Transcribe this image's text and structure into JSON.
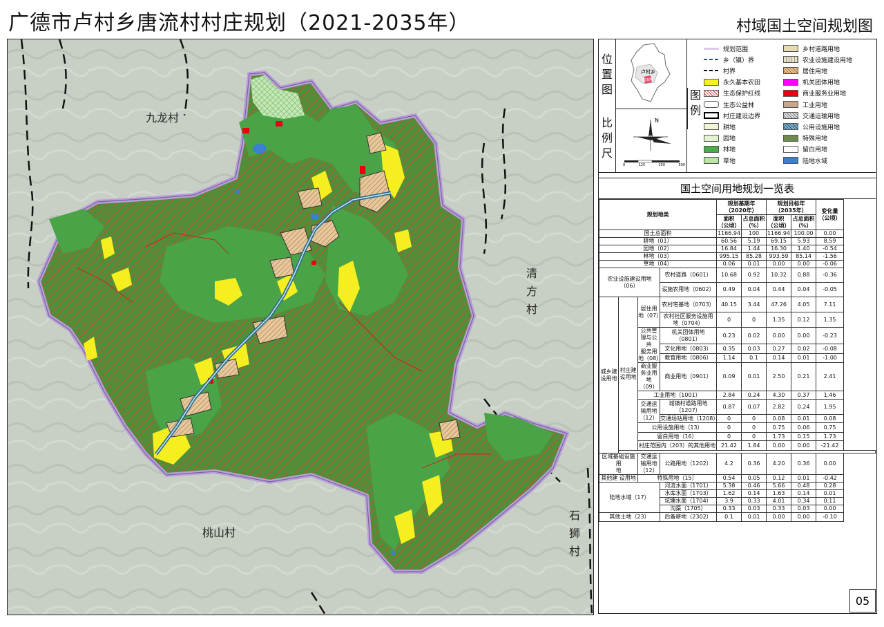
{
  "title": "广德市卢村乡唐流村村庄规划（2021-2035年）",
  "subtitle": "村域国土空间规划图",
  "village_labels": {
    "jiulong": "九龙村",
    "qingfang": "清方村",
    "taoshan": "桃山村",
    "shishi": "石狮村"
  },
  "side_captions": {
    "location": "位置图",
    "scale": "比例尺",
    "legend": "图例"
  },
  "location_map": {
    "region_label": "卢村乡",
    "village_tag": "唐流村"
  },
  "scale_bar": {
    "north": "N",
    "ticks": [
      "0",
      "125",
      "250",
      "",
      "500"
    ]
  },
  "legend": [
    {
      "label": "规划范围",
      "swatch": "#d8c8e8",
      "kind": "line-purple"
    },
    {
      "label": "乡村道路用地",
      "swatch": "#e4dcb0"
    },
    {
      "label": "乡（镇）界",
      "swatch": "#1f4e9c",
      "kind": "line-dash-blue"
    },
    {
      "label": "农业设施建设用地",
      "swatch": "#e9e1c4",
      "kind": "hatch-thin"
    },
    {
      "label": "村界",
      "swatch": "#000000",
      "kind": "line-dash"
    },
    {
      "label": "居住用地",
      "swatch": "#f2c78e",
      "kind": "hatch-brown"
    },
    {
      "label": "永久基本农田",
      "swatch": "#f5f221"
    },
    {
      "label": "机关团体用地",
      "swatch": "#ff00ff"
    },
    {
      "label": "生态保护红线",
      "swatch": "#ffffff",
      "kind": "hatch-red"
    },
    {
      "label": "商业服务业用地",
      "swatch": "#e60012"
    },
    {
      "label": "生态公益林",
      "swatch": "#ffffff",
      "kind": "outline-round"
    },
    {
      "label": "工业用地",
      "swatch": "#c9a58a"
    },
    {
      "label": "村庄建设边界",
      "swatch": "#ffffff",
      "kind": "outline-bold"
    },
    {
      "label": "交通运输用地",
      "swatch": "#b9b9b9",
      "kind": "hatch-gray"
    },
    {
      "label": "耕地",
      "swatch": "#f2f5d8"
    },
    {
      "label": "公用设施用地",
      "swatch": "#2d6e8c",
      "kind": "hatch-teal"
    },
    {
      "label": "园地",
      "swatch": "#e4f3cf"
    },
    {
      "label": "特殊用地",
      "swatch": "#6f8a4a"
    },
    {
      "label": "林地",
      "swatch": "#4cab4c"
    },
    {
      "label": "留白用地",
      "swatch": "#ffffff"
    },
    {
      "label": "草地",
      "swatch": "#b9e6a2"
    },
    {
      "label": "陆地水域",
      "swatch": "#3a7fd0"
    }
  ],
  "table": {
    "title": "国土空间用地规划一览表",
    "header": {
      "category": "规划地类",
      "base_year": "规划基期年\n（2020年）",
      "target_year": "规划目标年\n（2035年）",
      "change": "变化量\n（公顷）",
      "area": "面积\n（公顷）",
      "share": "占总面积\n（%）"
    },
    "rows": [
      {
        "c1": "国土总面积",
        "v": [
          "1166.94",
          "100",
          "1166.94",
          "100.00",
          "0.00"
        ]
      },
      {
        "c1": "耕地（01）",
        "v": [
          "60.56",
          "5.19",
          "69.15",
          "5.93",
          "8.59"
        ]
      },
      {
        "c1": "园地（02）",
        "v": [
          "16.84",
          "1.44",
          "16.30",
          "1.40",
          "-0.54"
        ]
      },
      {
        "c1": "林地（03）",
        "v": [
          "995.15",
          "85.28",
          "993.59",
          "85.14",
          "-1.56"
        ]
      },
      {
        "c1": "草地（04）",
        "v": [
          "0.06",
          "0.01",
          "0.00",
          "0.00",
          "-0.06"
        ]
      }
    ],
    "agri": {
      "group": "农业设施建设用地\n（06）",
      "rows": [
        {
          "c": "农村道路（0601）",
          "v": [
            "10.68",
            "0.92",
            "10.32",
            "0.88",
            "-0.36"
          ]
        },
        {
          "c": "设施农用地（0602）",
          "v": [
            "0.49",
            "0.04",
            "0.44",
            "0.04",
            "-0.05"
          ]
        }
      ]
    },
    "urban": {
      "group": "城乡建\n设用地",
      "sub": "村庄建\n设用地",
      "residential": "居住用地（07）",
      "res_rows": [
        {
          "c": "农村宅基地（0703）",
          "v": [
            "40.15",
            "3.44",
            "47.26",
            "4.05",
            "7.11"
          ]
        },
        {
          "c": "农村社区服务设施用\n地（0704）",
          "v": [
            "0",
            "0",
            "1.35",
            "0.12",
            "1.35"
          ]
        }
      ],
      "public": "公共管理与公共\n服务用地（08）",
      "pub_rows": [
        {
          "c": "机关团体用地\n（0801）",
          "v": [
            "0.23",
            "0.02",
            "0.00",
            "0.00",
            "-0.23"
          ]
        },
        {
          "c": "文化用地（0803）",
          "v": [
            "0.35",
            "0.03",
            "0.27",
            "0.02",
            "-0.08"
          ]
        },
        {
          "c": "教育用地（0806）",
          "v": [
            "1.14",
            "0.1",
            "0.14",
            "0.01",
            "-1.00"
          ]
        }
      ],
      "commercial": "商业服务业用地\n（09）",
      "com_row": {
        "c": "商业用地（0901）",
        "v": [
          "0.09",
          "0.01",
          "2.50",
          "0.21",
          "2.41"
        ]
      },
      "industrial": {
        "c": "工业用地（1001）",
        "v": [
          "2.84",
          "0.24",
          "4.30",
          "0.37",
          "1.46"
        ]
      },
      "transport": "交通运输用地\n（12）",
      "trans_rows": [
        {
          "c": "城镇村道路用地\n（1207）",
          "v": [
            "0.87",
            "0.07",
            "2.82",
            "0.24",
            "1.95"
          ]
        },
        {
          "c": "交通场站用地（1208）",
          "v": [
            "0",
            "0",
            "0.08",
            "0.01",
            "0.08"
          ]
        }
      ],
      "utility": {
        "c": "公用设施用地（13）",
        "v": [
          "0",
          "0",
          "0.75",
          "0.06",
          "0.75"
        ]
      },
      "reserve": {
        "c": "留白用地（16）",
        "v": [
          "0",
          "0",
          "1.73",
          "0.15",
          "1.73"
        ]
      },
      "other_in": {
        "c": "村庄范围内（203）的其他用地",
        "v": [
          "21.42",
          "1.84",
          "0.00",
          "0.00",
          "-21.42"
        ]
      }
    },
    "regional": {
      "group": "区域基础设施用\n地",
      "sub": "交通运输用地\n（12）",
      "row": {
        "c": "公路用地（1202）",
        "v": [
          "4.2",
          "0.36",
          "4.20",
          "0.36",
          "0.00"
        ]
      }
    },
    "other_build": {
      "group": "其他建 设用地",
      "c": "特殊用地（15）",
      "v": [
        "0.54",
        "0.05",
        "0.12",
        "0.01",
        "-0.42"
      ]
    },
    "water": {
      "group": "陆地水域（17）",
      "rows": [
        {
          "c": "河流水面（1701）",
          "v": [
            "5.38",
            "0.46",
            "5.66",
            "0.48",
            "0.28"
          ]
        },
        {
          "c": "水库水面（1703）",
          "v": [
            "1.62",
            "0.14",
            "1.63",
            "0.14",
            "0.01"
          ]
        },
        {
          "c": "坑塘水面（1704）",
          "v": [
            "3.9",
            "0.33",
            "4.01",
            "0.34",
            "0.11"
          ]
        },
        {
          "c": "沟渠（1705）",
          "v": [
            "0.33",
            "0.03",
            "0.33",
            "0.03",
            "0.00"
          ]
        }
      ]
    },
    "other_land": {
      "group": "其他土地（23）",
      "c": "后备耕地（2302）",
      "v": [
        "0.1",
        "0.01",
        "0.00",
        "0.00",
        "-0.10"
      ]
    }
  },
  "page_number": "05"
}
